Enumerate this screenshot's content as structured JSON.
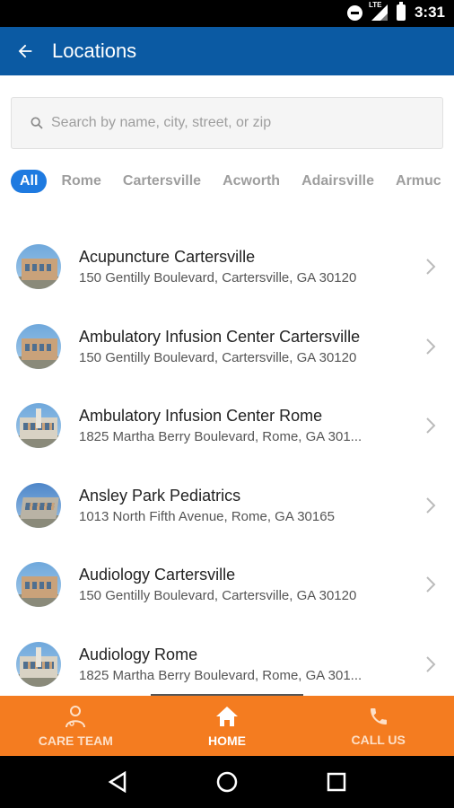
{
  "status": {
    "time": "3:31",
    "network": "LTE"
  },
  "header": {
    "title": "Locations"
  },
  "search": {
    "placeholder": "Search by name, city, street, or zip"
  },
  "filters": [
    "All",
    "Rome",
    "Cartersville",
    "Acworth",
    "Adairsville",
    "Armuc"
  ],
  "locations": [
    {
      "name": "Acupuncture Cartersville",
      "address": "150 Gentilly Boulevard, Cartersville, GA 30120",
      "image": "cartersville-building"
    },
    {
      "name": "Ambulatory Infusion Center Cartersville",
      "address": "150 Gentilly Boulevard, Cartersville, GA 30120",
      "image": "cartersville-building"
    },
    {
      "name": "Ambulatory Infusion Center Rome",
      "address": "1825 Martha Berry Boulevard, Rome, GA 301...",
      "image": "rome-building"
    },
    {
      "name": "Ansley Park Pediatrics",
      "address": "1013 North Fifth Avenue, Rome, GA 30165",
      "image": "ansley-building"
    },
    {
      "name": "Audiology Cartersville",
      "address": "150 Gentilly Boulevard, Cartersville, GA 30120",
      "image": "cartersville-building"
    },
    {
      "name": "Audiology Rome",
      "address": "1825 Martha Berry Boulevard, Rome, GA 301...",
      "image": "rome-building"
    }
  ],
  "bottom_nav": [
    {
      "label": "CARE TEAM",
      "icon": "doctor-icon"
    },
    {
      "label": "HOME",
      "icon": "home-icon"
    },
    {
      "label": "CALL US",
      "icon": "phone-icon"
    }
  ],
  "colors": {
    "appbar": "#0b5aa3",
    "accent": "#1e7ae0",
    "bottom_nav": "#f47c20"
  }
}
